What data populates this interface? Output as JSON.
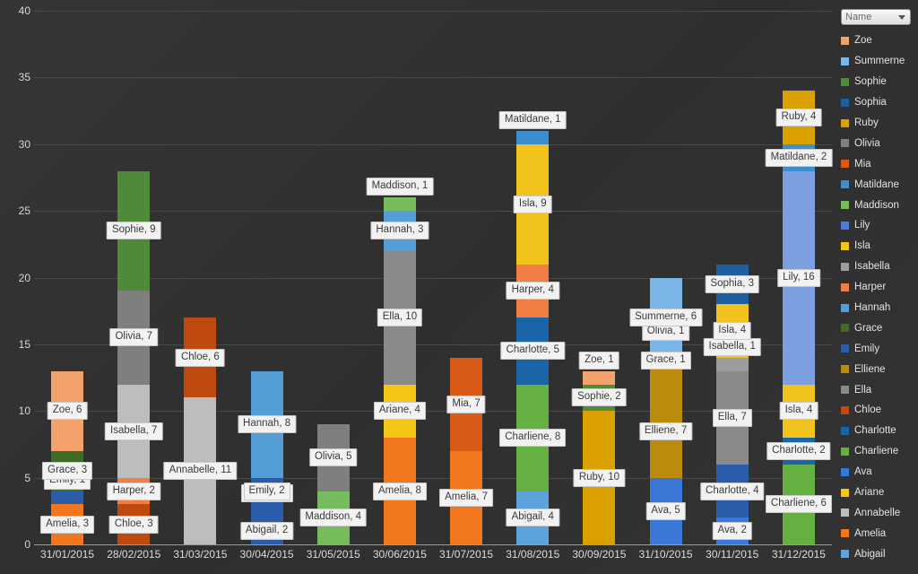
{
  "control": {
    "name_select_label": "Name",
    "caret_icon": "chevron-down-icon"
  },
  "chart_data": {
    "type": "bar",
    "stacked": true,
    "title": "",
    "xlabel": "",
    "ylabel": "",
    "ylim": [
      0,
      40
    ],
    "yticks": [
      0,
      5,
      10,
      15,
      20,
      25,
      30,
      35,
      40
    ],
    "grid": true,
    "legend_position": "right",
    "categories": [
      "31/01/2015",
      "28/02/2015",
      "31/03/2015",
      "30/04/2015",
      "31/05/2015",
      "30/06/2015",
      "31/07/2015",
      "31/08/2015",
      "30/09/2015",
      "31/10/2015",
      "30/11/2015",
      "31/12/2015"
    ],
    "legend_entries": [
      {
        "name": "Zoe",
        "color": "#f4a26b"
      },
      {
        "name": "Summerne",
        "color": "#7cb5e8"
      },
      {
        "name": "Sophie",
        "color": "#4f8a3b"
      },
      {
        "name": "Sophia",
        "color": "#1f5fa0"
      },
      {
        "name": "Ruby",
        "color": "#d9a000"
      },
      {
        "name": "Olivia",
        "color": "#7f7f7f"
      },
      {
        "name": "Mia",
        "color": "#d85a14"
      },
      {
        "name": "Matildane",
        "color": "#3c8ed0"
      },
      {
        "name": "Maddison",
        "color": "#76bb5c"
      },
      {
        "name": "Lily",
        "color": "#4a7fd4"
      },
      {
        "name": "Isla",
        "color": "#f2c31c"
      },
      {
        "name": "Isabella",
        "color": "#9c9c9c"
      },
      {
        "name": "Harper",
        "color": "#f07e45"
      },
      {
        "name": "Hannah",
        "color": "#549ed8"
      },
      {
        "name": "Grace",
        "color": "#3f6b2a"
      },
      {
        "name": "Emily",
        "color": "#2a5caa"
      },
      {
        "name": "Elliene",
        "color": "#bb8b0c"
      },
      {
        "name": "Ella",
        "color": "#8a8a8a"
      },
      {
        "name": "Chloe",
        "color": "#bf4a10"
      },
      {
        "name": "Charlotte",
        "color": "#1a65a8"
      },
      {
        "name": "Charliene",
        "color": "#65b041"
      },
      {
        "name": "Ava",
        "color": "#3a78d8"
      },
      {
        "name": "Ariane",
        "color": "#f5c518"
      },
      {
        "name": "Annabelle",
        "color": "#bdbdbd"
      },
      {
        "name": "Amelia",
        "color": "#f2761b"
      },
      {
        "name": "Abigail",
        "color": "#5ca3de"
      }
    ],
    "columns": [
      {
        "category": "31/01/2015",
        "total": 13,
        "segments": [
          {
            "name": "Amelia",
            "value": 3,
            "label": "Amelia, 3",
            "color": "#f2761b"
          },
          {
            "name": "Emily",
            "value": 1,
            "label": "Emily, 1",
            "color": "#2a5caa"
          },
          {
            "name": "Grace",
            "value": 3,
            "label": "Grace, 3",
            "color": "#3f6b2a"
          },
          {
            "name": "Zoe",
            "value": 6,
            "label": "Zoe, 6",
            "color": "#f4a26b"
          }
        ]
      },
      {
        "category": "28/02/2015",
        "total": 28,
        "segments": [
          {
            "name": "Chloe",
            "value": 3,
            "label": "Chloe, 3",
            "color": "#bf4a10"
          },
          {
            "name": "Harper",
            "value": 2,
            "label": "Harper, 2",
            "color": "#f07e45"
          },
          {
            "name": "Isabella",
            "value": 7,
            "label": "Isabella, 7",
            "color": "#bdbdbd"
          },
          {
            "name": "Olivia",
            "value": 7,
            "label": "Olivia, 7",
            "color": "#7f7f7f"
          },
          {
            "name": "Sophie",
            "value": 9,
            "label": "Sophie, 9",
            "color": "#4f8a3b"
          }
        ]
      },
      {
        "category": "31/03/2015",
        "total": 17,
        "segments": [
          {
            "name": "Annabelle",
            "value": 11,
            "label": "Annabelle, 11",
            "color": "#bdbdbd"
          },
          {
            "name": "Chloe",
            "value": 6,
            "label": "Chloe, 6",
            "color": "#bf4a10"
          }
        ]
      },
      {
        "category": "30/04/2015",
        "total": 13,
        "segments": [
          {
            "name": "Abigail",
            "value": 2,
            "label": "Abigail, 2",
            "color": "#2a5caa"
          },
          {
            "name": "Ariane",
            "value": 1,
            "label": "Ariane, 1",
            "color": "#2a5caa"
          },
          {
            "name": "Emily",
            "value": 2,
            "label": "Emily, 2",
            "color": "#2a5caa"
          },
          {
            "name": "Hannah",
            "value": 8,
            "label": "Hannah, 8",
            "color": "#549ed8"
          }
        ]
      },
      {
        "category": "31/05/2015",
        "total": 9,
        "segments": [
          {
            "name": "Maddison",
            "value": 4,
            "label": "Maddison, 4",
            "color": "#76bb5c"
          },
          {
            "name": "Olivia",
            "value": 5,
            "label": "Olivia, 5",
            "color": "#7f7f7f"
          }
        ]
      },
      {
        "category": "30/06/2015",
        "total": 26,
        "segments": [
          {
            "name": "Amelia",
            "value": 8,
            "label": "Amelia, 8",
            "color": "#f2761b"
          },
          {
            "name": "Ariane",
            "value": 4,
            "label": "Ariane, 4",
            "color": "#f5c518"
          },
          {
            "name": "Ella",
            "value": 10,
            "label": "Ella, 10",
            "color": "#8a8a8a"
          },
          {
            "name": "Hannah",
            "value": 3,
            "label": "Hannah, 3",
            "color": "#549ed8"
          },
          {
            "name": "Maddison",
            "value": 1,
            "label": "Maddison, 1",
            "color": "#76bb5c"
          }
        ]
      },
      {
        "category": "31/07/2015",
        "total": 14,
        "segments": [
          {
            "name": "Amelia",
            "value": 7,
            "label": "Amelia, 7",
            "color": "#f2761b"
          },
          {
            "name": "Mia",
            "value": 7,
            "label": "Mia, 7",
            "color": "#d85a14"
          }
        ]
      },
      {
        "category": "31/08/2015",
        "total": 31,
        "segments": [
          {
            "name": "Abigail",
            "value": 4,
            "label": "Abigail, 4",
            "color": "#5ca3de"
          },
          {
            "name": "Charliene",
            "value": 8,
            "label": "Charliene, 8",
            "color": "#65b041"
          },
          {
            "name": "Charlotte",
            "value": 5,
            "label": "Charlotte, 5",
            "color": "#1a65a8"
          },
          {
            "name": "Harper",
            "value": 4,
            "label": "Harper, 4",
            "color": "#f07e45"
          },
          {
            "name": "Isla",
            "value": 9,
            "label": "Isla, 9",
            "color": "#f2c31c"
          },
          {
            "name": "Matildane",
            "value": 1,
            "label": "Matildane, 1",
            "color": "#3c8ed0"
          }
        ]
      },
      {
        "category": "30/09/2015",
        "total": 13,
        "segments": [
          {
            "name": "Ruby",
            "value": 10,
            "label": "Ruby, 10",
            "color": "#d9a000"
          },
          {
            "name": "Sophie",
            "value": 2,
            "label": "Sophie, 2",
            "color": "#4f8a3b"
          },
          {
            "name": "Zoe",
            "value": 1,
            "label": "Zoe, 1",
            "color": "#f4a26b"
          }
        ]
      },
      {
        "category": "31/10/2015",
        "total": 20,
        "segments": [
          {
            "name": "Ava",
            "value": 5,
            "label": "Ava, 5",
            "color": "#3a78d8"
          },
          {
            "name": "Elliene",
            "value": 7,
            "label": "Elliene, 7",
            "color": "#bb8b0c"
          },
          {
            "name": "Grace",
            "value": 1,
            "label": "Grace, 1",
            "color": "#bb8b0c"
          },
          {
            "name": "Olivia",
            "value": 1,
            "label": "Olivia, 1",
            "color": "#bb8b0c"
          },
          {
            "name": "Summerne",
            "value": 6,
            "label": "Summerne, 6",
            "color": "#7cb5e8"
          }
        ]
      },
      {
        "category": "30/11/2015",
        "total": 21,
        "segments": [
          {
            "name": "Ava",
            "value": 2,
            "label": "Ava, 2",
            "color": "#3a78d8"
          },
          {
            "name": "Charlotte",
            "value": 4,
            "label": "Charlotte, 4",
            "color": "#2a5caa"
          },
          {
            "name": "Ella",
            "value": 7,
            "label": "Ella, 7",
            "color": "#8a8a8a"
          },
          {
            "name": "Isabella",
            "value": 1,
            "label": "Isabella, 1",
            "color": "#9c9c9c"
          },
          {
            "name": "Isla",
            "value": 4,
            "label": "Isla, 4",
            "color": "#f2c31c"
          },
          {
            "name": "Sophia",
            "value": 3,
            "label": "Sophia, 3",
            "color": "#1f5fa0"
          }
        ]
      },
      {
        "category": "31/12/2015",
        "total": 34,
        "segments": [
          {
            "name": "Charliene",
            "value": 6,
            "label": "Charliene, 6",
            "color": "#65b041"
          },
          {
            "name": "Charlotte",
            "value": 2,
            "label": "Charlotte, 2",
            "color": "#1a65a8"
          },
          {
            "name": "Isla",
            "value": 4,
            "label": "Isla, 4",
            "color": "#f2c31c"
          },
          {
            "name": "Lily",
            "value": 16,
            "label": "Lily, 16",
            "color": "#7c9fe0"
          },
          {
            "name": "Matildane",
            "value": 2,
            "label": "Matildane, 2",
            "color": "#3c8ed0"
          },
          {
            "name": "Ruby",
            "value": 4,
            "label": "Ruby, 4",
            "color": "#d9a000"
          }
        ]
      }
    ]
  }
}
